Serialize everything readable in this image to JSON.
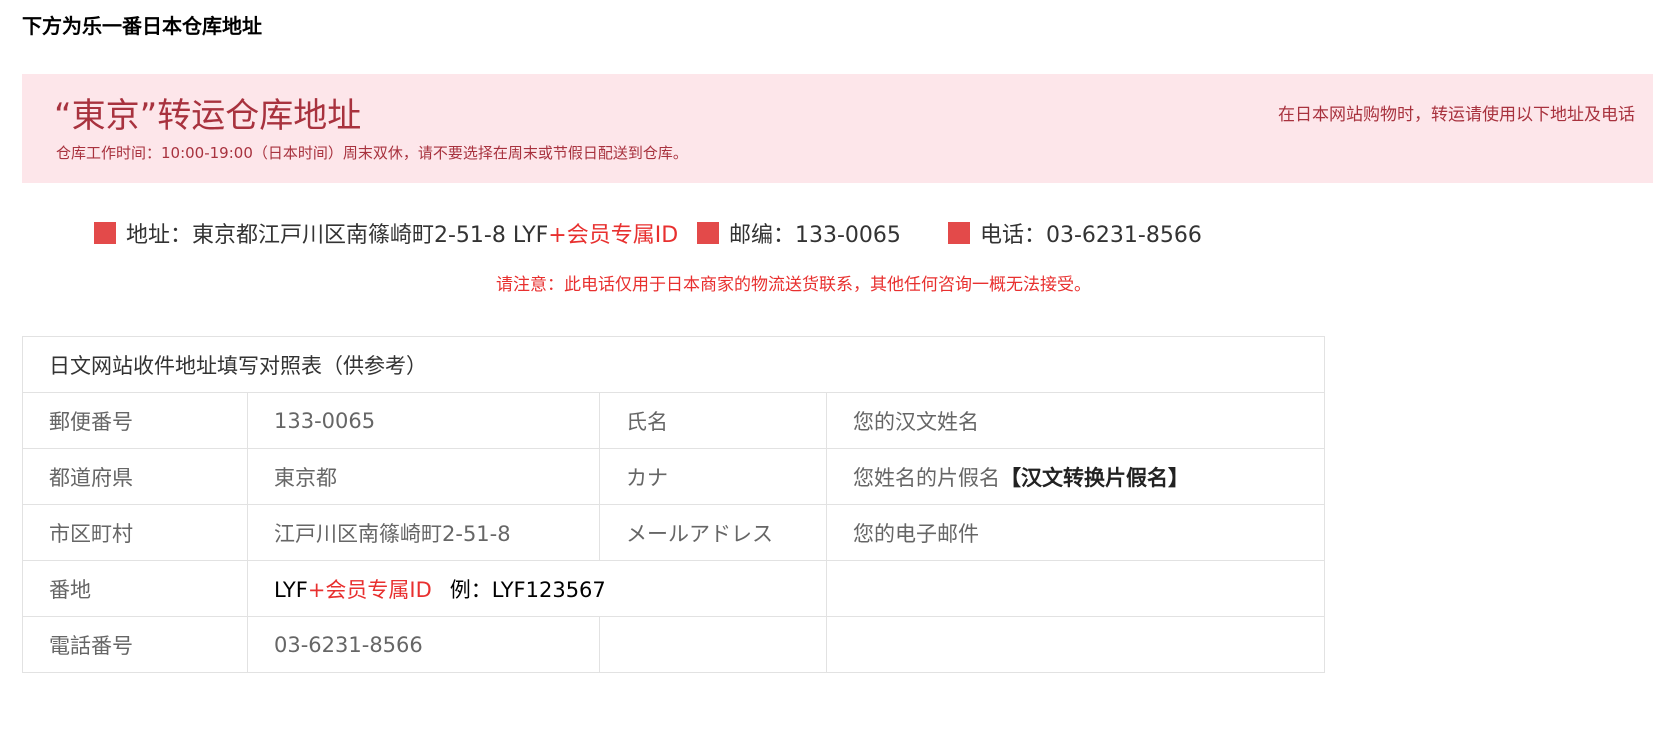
{
  "page_heading": "下方为乐一番日本仓库地址",
  "banner": {
    "title": "“東京”转运仓库地址",
    "hours": "仓库工作时间：10:00-19:00（日本时间）周末双休，请不要选择在周末或节假日配送到仓库。",
    "note": "在日本网站购物时，转运请使用以下地址及电话"
  },
  "address_line": {
    "address_label": "地址：東京都江戸川区南篠崎町2-51-8 LYF",
    "member_id": "+会员专属ID",
    "postal_label": "邮编：133-0065",
    "phone_label": "电话：03-6231-8566"
  },
  "notice": "请注意：此电话仅用于日本商家的物流送货联系，其他任何咨询一概无法接受。",
  "table": {
    "title": "日文网站收件地址填写对照表（供参考）",
    "rows": [
      {
        "label": "郵便番号",
        "value": "133-0065",
        "label2": "氏名",
        "value2": "您的汉文姓名"
      },
      {
        "label": "都道府県",
        "value": "東京都",
        "label2": "カナ",
        "value2": "您姓名的片假名",
        "value2_bold": "【汉文转换片假名】"
      },
      {
        "label": "市区町村",
        "value": "江戸川区南篠崎町2-51-8",
        "label2": "メールアドレス",
        "value2": "您的电子邮件"
      },
      {
        "label": "番地",
        "value_prefix": "LYF",
        "value_red": "+会员专属ID",
        "value_example": "例：LYF123567",
        "label2": "",
        "value2": ""
      },
      {
        "label": "電話番号",
        "value": "03-6231-8566",
        "label2": "",
        "value2": ""
      }
    ]
  },
  "colors": {
    "banner_bg": "#fde6ea",
    "banner_text": "#a8323e",
    "accent_red": "#e8302f",
    "marker_red": "#e34a4a"
  }
}
